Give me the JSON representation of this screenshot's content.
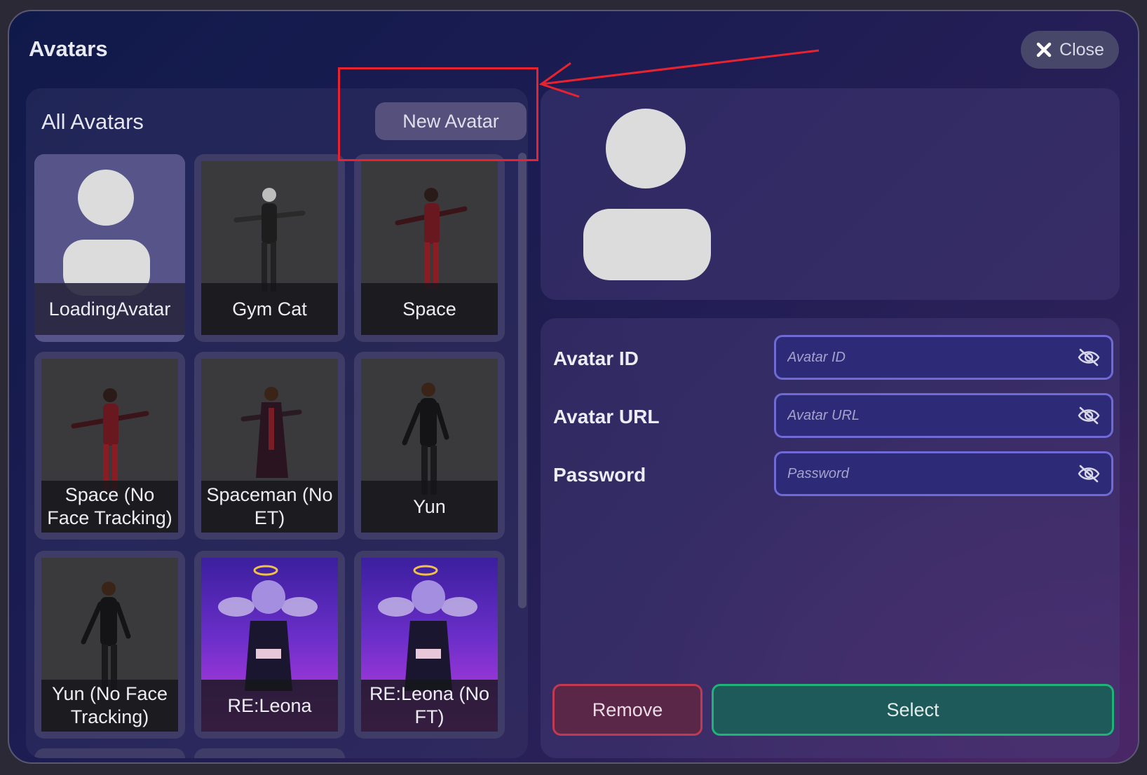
{
  "modal": {
    "title": "Avatars",
    "close_label": "Close"
  },
  "list": {
    "title": "All Avatars",
    "new_button_label": "New Avatar",
    "avatars": [
      {
        "name": "LoadingAvatar",
        "thumbnail": "placeholder-silhouette"
      },
      {
        "name": "Gym Cat",
        "thumbnail": "3d-character-tpose"
      },
      {
        "name": "Space",
        "thumbnail": "3d-character-tpose"
      },
      {
        "name": "Space (No Face Tracking)",
        "thumbnail": "3d-character-tpose"
      },
      {
        "name": "Spaceman (No ET)",
        "thumbnail": "3d-character-tpose"
      },
      {
        "name": "Yun",
        "thumbnail": "3d-character-standing"
      },
      {
        "name": "Yun (No Face Tracking)",
        "thumbnail": "3d-character-standing"
      },
      {
        "name": "RE:Leona",
        "thumbnail": "anime-character-art"
      },
      {
        "name": "RE:Leona (No FT)",
        "thumbnail": "anime-character-art"
      }
    ]
  },
  "details": {
    "preview_icon": "user-silhouette-icon",
    "fields": [
      {
        "label": "Avatar ID",
        "placeholder": "Avatar ID",
        "value": ""
      },
      {
        "label": "Avatar URL",
        "placeholder": "Avatar URL",
        "value": ""
      },
      {
        "label": "Password",
        "placeholder": "Password",
        "value": ""
      }
    ],
    "remove_label": "Remove",
    "select_label": "Select"
  },
  "annotation": {
    "color": "#e8232f",
    "target": "new-avatar-button"
  },
  "colors": {
    "accent": "#6f6ad6",
    "danger": "#c03a52",
    "success": "#1fb378"
  }
}
